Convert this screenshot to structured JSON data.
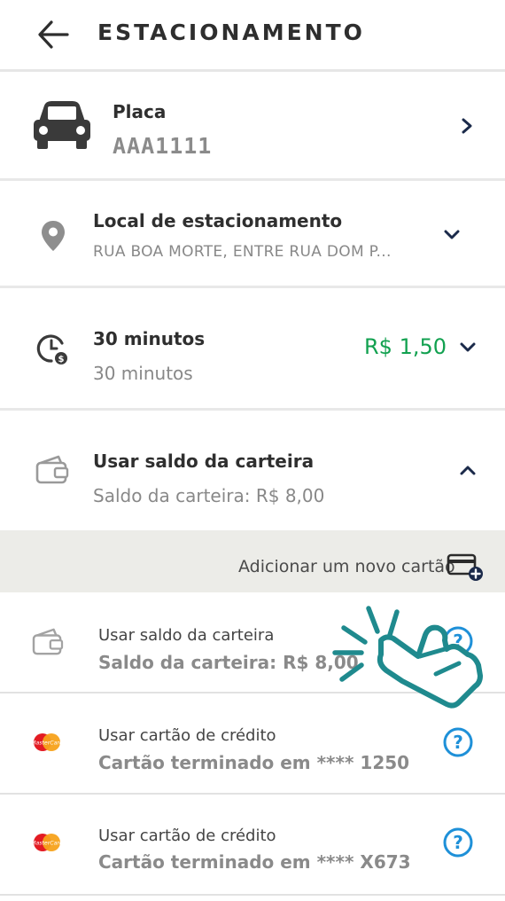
{
  "header": {
    "title": "ESTACIONAMENTO"
  },
  "plate": {
    "label": "Placa",
    "value": "AAA1111"
  },
  "location": {
    "label": "Local de estacionamento",
    "value": "RUA BOA MORTE, ENTRE RUA DOM P..."
  },
  "duration": {
    "label": "30 minutos",
    "value": "30 minutos",
    "price": "R$ 1,50"
  },
  "wallet": {
    "label": "Usar saldo da carteira",
    "balance": "Saldo da carteira: R$ 8,00"
  },
  "add_card": {
    "label": "Adicionar um novo cartão"
  },
  "payment_options": [
    {
      "title": "Usar saldo da carteira",
      "subtitle": "Saldo da carteira: R$ 8,00",
      "icon": "wallet-icon"
    },
    {
      "title": "Usar cartão de crédito",
      "subtitle": "Cartão terminado em **** 1250",
      "icon": "mastercard-icon",
      "brand_text": "MasterCard"
    },
    {
      "title": "Usar cartão de crédito",
      "subtitle": "Cartão terminado em **** X673",
      "icon": "mastercard-icon",
      "brand_text": "MasterCard"
    }
  ],
  "colors": {
    "price_green": "#12a150",
    "help_blue": "#1e90d8",
    "hand_teal": "#1f8a8e",
    "navy": "#1b2a4a"
  }
}
